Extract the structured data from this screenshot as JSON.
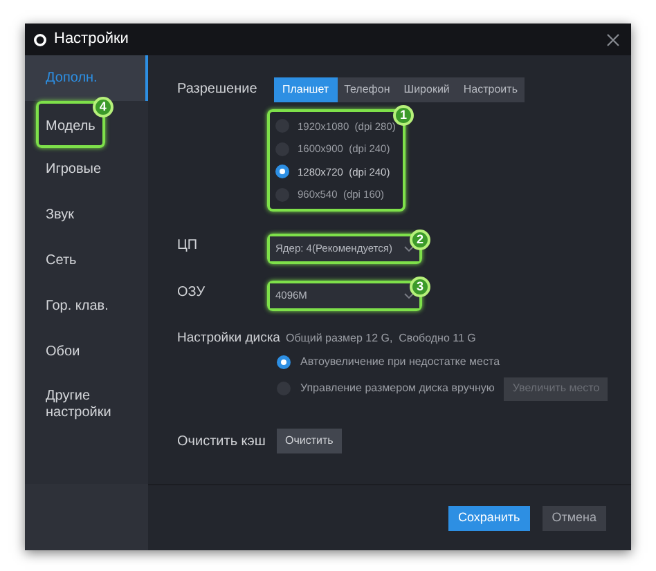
{
  "window": {
    "title": "Настройки"
  },
  "sidebar": {
    "items": [
      {
        "label": "Дополн.",
        "selected": true
      },
      {
        "label": "Модель",
        "selected": false,
        "badge": "4"
      },
      {
        "label": "Игровые",
        "selected": false
      },
      {
        "label": "Звук",
        "selected": false
      },
      {
        "label": "Сеть",
        "selected": false
      },
      {
        "label": "Гор. клав.",
        "selected": false
      },
      {
        "label": "Обои",
        "selected": false
      },
      {
        "label": "Другие настройки",
        "selected": false
      }
    ]
  },
  "resolution": {
    "label": "Разрешение",
    "tabs": [
      {
        "label": "Планшет",
        "selected": true
      },
      {
        "label": "Телефон",
        "selected": false
      },
      {
        "label": "Широкий",
        "selected": false
      },
      {
        "label": "Настроить",
        "selected": false
      }
    ],
    "badge": "1",
    "options": [
      {
        "label": "1920x1080  (dpi 280)",
        "selected": false
      },
      {
        "label": "1600x900  (dpi 240)",
        "selected": false
      },
      {
        "label": "1280x720  (dpi 240)",
        "selected": true
      },
      {
        "label": "960x540  (dpi 160)",
        "selected": false
      }
    ]
  },
  "cpu": {
    "label": "ЦП",
    "value": "Ядер: 4(Рекомендуется)",
    "badge": "2"
  },
  "ram": {
    "label": "ОЗУ",
    "value": "4096M",
    "badge": "3"
  },
  "disk": {
    "label": "Настройки диска",
    "info": "Общий размер 12 G,  Свободно 11 G",
    "options": [
      {
        "label": "Автоувеличение при недостатке места",
        "selected": true
      },
      {
        "label": "Управление размером диска вручную",
        "selected": false,
        "button": "Увеличить место",
        "button_disabled": true
      }
    ]
  },
  "cache": {
    "label": "Очистить кэш",
    "button": "Очистить"
  },
  "buttons": [
    {
      "label": "Сохранить",
      "kind": "primary"
    },
    {
      "label": "Отмена",
      "kind": "secondary"
    }
  ]
}
